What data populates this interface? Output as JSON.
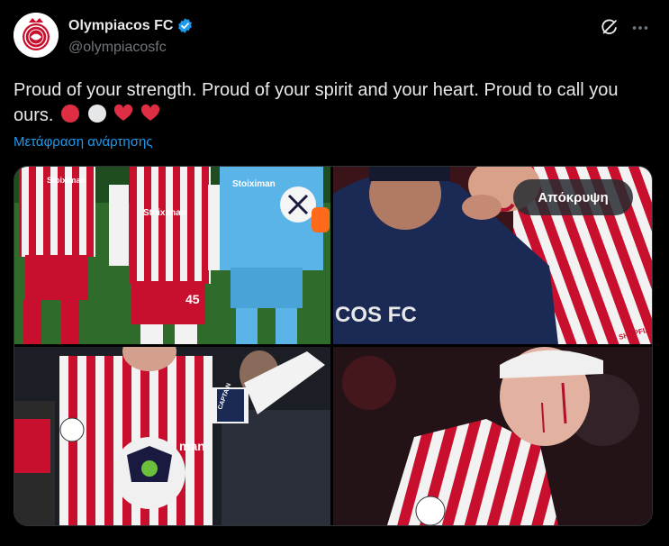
{
  "author": {
    "display_name": "Olympiacos FC",
    "handle": "@olympiacosfc",
    "verified": true,
    "verified_color": "#1d9bf0",
    "avatar": "olympiacos-crest"
  },
  "post": {
    "text": "Proud of your strength. Proud of your spirit and your heart. Proud to call you ours.",
    "emojis": [
      "red-circle",
      "white-circle",
      "red-heart",
      "red-heart"
    ],
    "translate_label": "Μετάφραση ανάρτησης"
  },
  "header_actions": {
    "grok_icon": "grok-icon",
    "more_icon": "more-horizontal-icon"
  },
  "media": {
    "photo_count": 4,
    "hide_button_label": "Απόκρυψη",
    "photos": [
      {
        "kit_texts": [
          "Stoiximan",
          "Stoiximan",
          "Stoiximan"
        ],
        "number": "45"
      },
      {
        "kit_texts": [
          "COS FC",
          "SHOPFLIX"
        ]
      },
      {
        "kit_texts": [
          "man",
          "CAPTAIN"
        ]
      },
      {
        "kit_texts": []
      }
    ]
  },
  "colors": {
    "background": "#000000",
    "text": "#e7e9ea",
    "secondary_text": "#71767b",
    "link": "#1d9bf0",
    "kit_red": "#c8102e"
  }
}
